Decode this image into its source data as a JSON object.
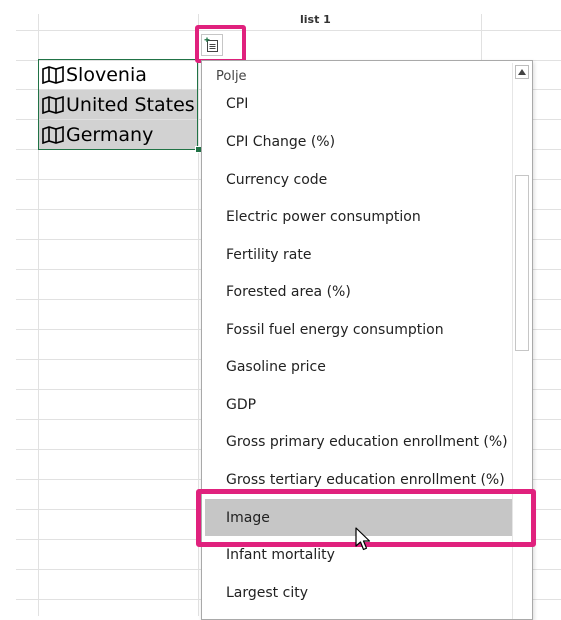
{
  "sheet": {
    "title": "list 1",
    "cells": [
      {
        "text": "Slovenia",
        "icon": "map-icon"
      },
      {
        "text": "United States",
        "icon": "map-icon"
      },
      {
        "text": "Germany",
        "icon": "map-icon"
      }
    ]
  },
  "insert_data_button": {
    "icon": "insert-data-icon"
  },
  "dropdown": {
    "header": "Polje",
    "items": [
      "CPI",
      "CPI Change (%)",
      "Currency code",
      "Electric power consumption",
      "Fertility rate",
      "Forested area (%)",
      "Fossil fuel energy consumption",
      "Gasoline price",
      "GDP",
      "Gross primary education enrollment (%)",
      "Gross tertiary education enrollment (%)",
      "Image",
      "Infant mortality",
      "Largest city"
    ],
    "hovered_item": "Image"
  },
  "colors": {
    "highlight": "#e0217d",
    "selection_border": "#217346",
    "selected_cell": "#d2d2d2",
    "hover_item": "#c6c6c6"
  }
}
